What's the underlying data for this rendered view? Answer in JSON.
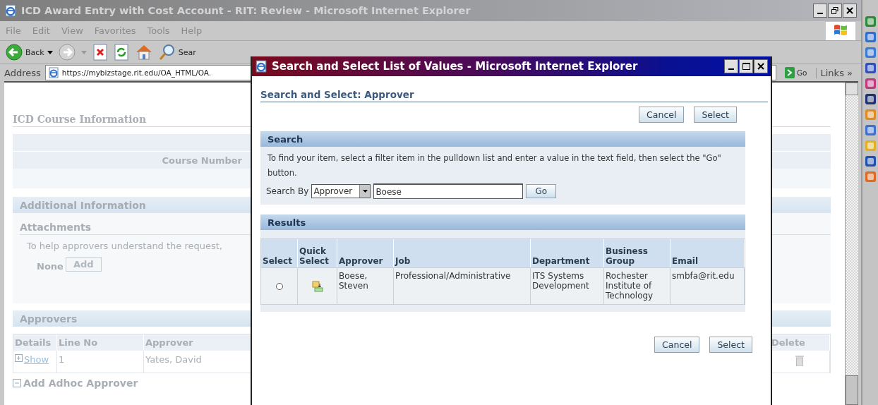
{
  "browser": {
    "title": "ICD Award Entry with Cost Account - RIT: Review - Microsoft Internet Explorer",
    "menu": [
      "File",
      "Edit",
      "View",
      "Favorites",
      "Tools",
      "Help"
    ],
    "toolbar": {
      "back": "Back",
      "search": "Sear"
    },
    "address": {
      "label": "Address",
      "url": "https://mybizstage.rit.edu/OA_HTML/OA."
    },
    "go": "Go",
    "links": "Links »"
  },
  "page": {
    "course": {
      "title": "ICD Course Information",
      "field_label": "Course Number"
    },
    "additional": {
      "title": "Additional Information",
      "attachments_title": "Attachments",
      "hint": "To help approvers understand the request,",
      "none": "None",
      "add_button": "Add"
    },
    "approvers": {
      "title": "Approvers",
      "columns": [
        "Details",
        "Line No",
        "Approver",
        "Delete"
      ],
      "rows": [
        {
          "details": "Show",
          "line_no": "1",
          "approver": "Yates, David"
        }
      ],
      "adhoc": {
        "label": "Add Adhoc Approver",
        "expanded": true
      }
    }
  },
  "dialog": {
    "title": "Search and Select List of Values - Microsoft Internet Explorer",
    "heading": "Search and Select: Approver",
    "top_buttons": [
      "Cancel",
      "Select"
    ],
    "search": {
      "title": "Search",
      "instructions": "To find your item, select a filter item in the pulldown list and enter a value in the text field, then select the \"Go\" button.",
      "search_by_label": "Search By",
      "filter": "Approver",
      "value": "Boese",
      "go": "Go"
    },
    "results": {
      "title": "Results",
      "columns": [
        "Select",
        "Quick Select",
        "Approver",
        "Job",
        "Department",
        "Business Group",
        "Email"
      ],
      "rows": [
        {
          "selected": false,
          "approver": "Boese, Steven",
          "job": "Professional/Administrative",
          "department": "ITS Systems Development",
          "business_group": "Rochester Institute of Technology",
          "email": "smbfa@rit.edu"
        }
      ]
    },
    "bottom_buttons": [
      "Cancel",
      "Select"
    ]
  }
}
